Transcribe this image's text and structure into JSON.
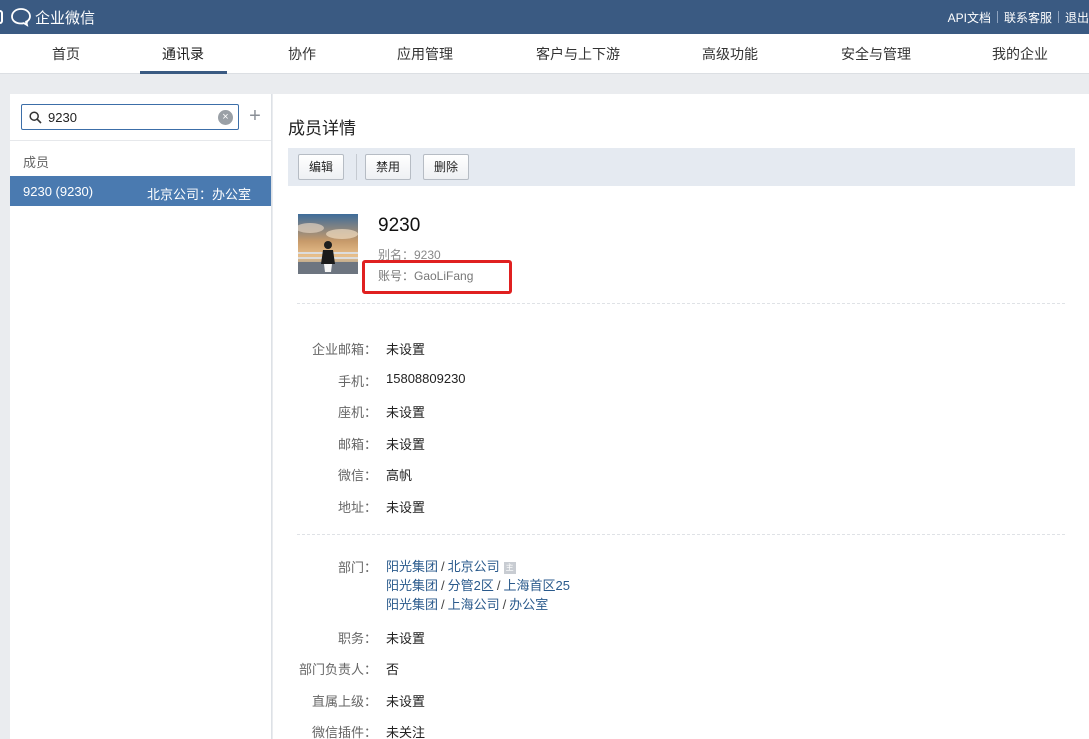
{
  "app": {
    "title": "企业微信",
    "top_links": [
      "API文档",
      "联系客服",
      "退出"
    ]
  },
  "nav": {
    "items": [
      "首页",
      "通讯录",
      "协作",
      "应用管理",
      "客户与上下游",
      "高级功能",
      "安全与管理",
      "我的企业"
    ],
    "active_index": 1
  },
  "sidebar": {
    "search_value": "9230",
    "clear_symbol": "×",
    "add_symbol": "+",
    "section_label": "成员",
    "member": {
      "name": "9230 (9230)",
      "department": "北京公司：办公室"
    }
  },
  "main": {
    "title": "成员详情",
    "toolbar": {
      "edit": "编辑",
      "disable": "禁用",
      "delete": "删除"
    },
    "profile": {
      "name": "9230",
      "alias": "别名：9230",
      "account": "账号：GaoLiFang"
    },
    "fields": [
      {
        "label": "企业邮箱：",
        "value": "未设置"
      },
      {
        "label": "手机：",
        "value": "15808809230"
      },
      {
        "label": "座机：",
        "value": "未设置"
      },
      {
        "label": "邮箱：",
        "value": "未设置"
      },
      {
        "label": "微信：",
        "value": "高帆"
      },
      {
        "label": "地址：",
        "value": "未设置"
      }
    ],
    "department_label": "部门：",
    "departments": [
      {
        "path": [
          "阳光集团",
          "北京公司"
        ],
        "primary": true,
        "badge": "主"
      },
      {
        "path": [
          "阳光集团",
          "分管2区",
          "上海首区25"
        ],
        "primary": false
      },
      {
        "path": [
          "阳光集团",
          "上海公司",
          "办公室"
        ],
        "primary": false
      }
    ],
    "fields2": [
      {
        "label": "职务：",
        "value": "未设置"
      },
      {
        "label": "部门负责人：",
        "value": "否"
      },
      {
        "label": "直属上级：",
        "value": "未设置"
      },
      {
        "label": "微信插件：",
        "value": "未关注"
      }
    ]
  },
  "colors": {
    "topbar": "#3a5a82",
    "selected_row": "#4a7ab0",
    "link": "#2a5a8c",
    "highlight": "#e02020"
  }
}
